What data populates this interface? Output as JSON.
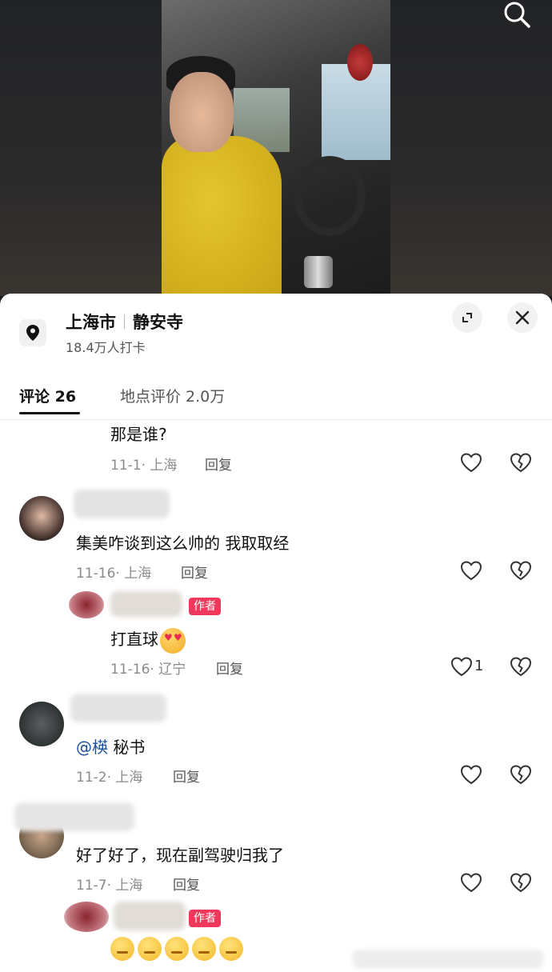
{
  "icons": {
    "search": "search-icon",
    "location": "location-pin-icon",
    "expand": "expand-icon",
    "close": "close-icon",
    "like": "heart-icon",
    "dislike": "broken-heart-icon"
  },
  "location": {
    "city": "上海市",
    "place": "静安寺",
    "checkins": "18.4万人打卡"
  },
  "tabs": [
    {
      "label": "评论 26",
      "active": true
    },
    {
      "label": "地点评价 2.0万",
      "active": false
    }
  ],
  "comments": [
    {
      "text": "那是谁?",
      "date": "11-1",
      "region": "上海",
      "reply": "回复"
    },
    {
      "text": "集美咋谈到这么帅的 我取取经",
      "date": "11-16",
      "region": "上海",
      "reply": "回复"
    },
    {
      "badge": "作者",
      "text": "打直球",
      "date": "11-16",
      "region": "辽宁",
      "reply": "回复",
      "likes": "1"
    },
    {
      "mention": "@楧",
      "text": "秘书",
      "date": "11-2",
      "region": "上海",
      "reply": "回复"
    },
    {
      "text": "好了好了，现在副驾驶归我了",
      "date": "11-7",
      "region": "上海",
      "reply": "回复"
    },
    {
      "badge": "作者",
      "emoji_count": 5
    }
  ],
  "colors": {
    "badge": "#f0385c",
    "mention": "#1a4f9c",
    "meta": "#8a8a8a"
  }
}
